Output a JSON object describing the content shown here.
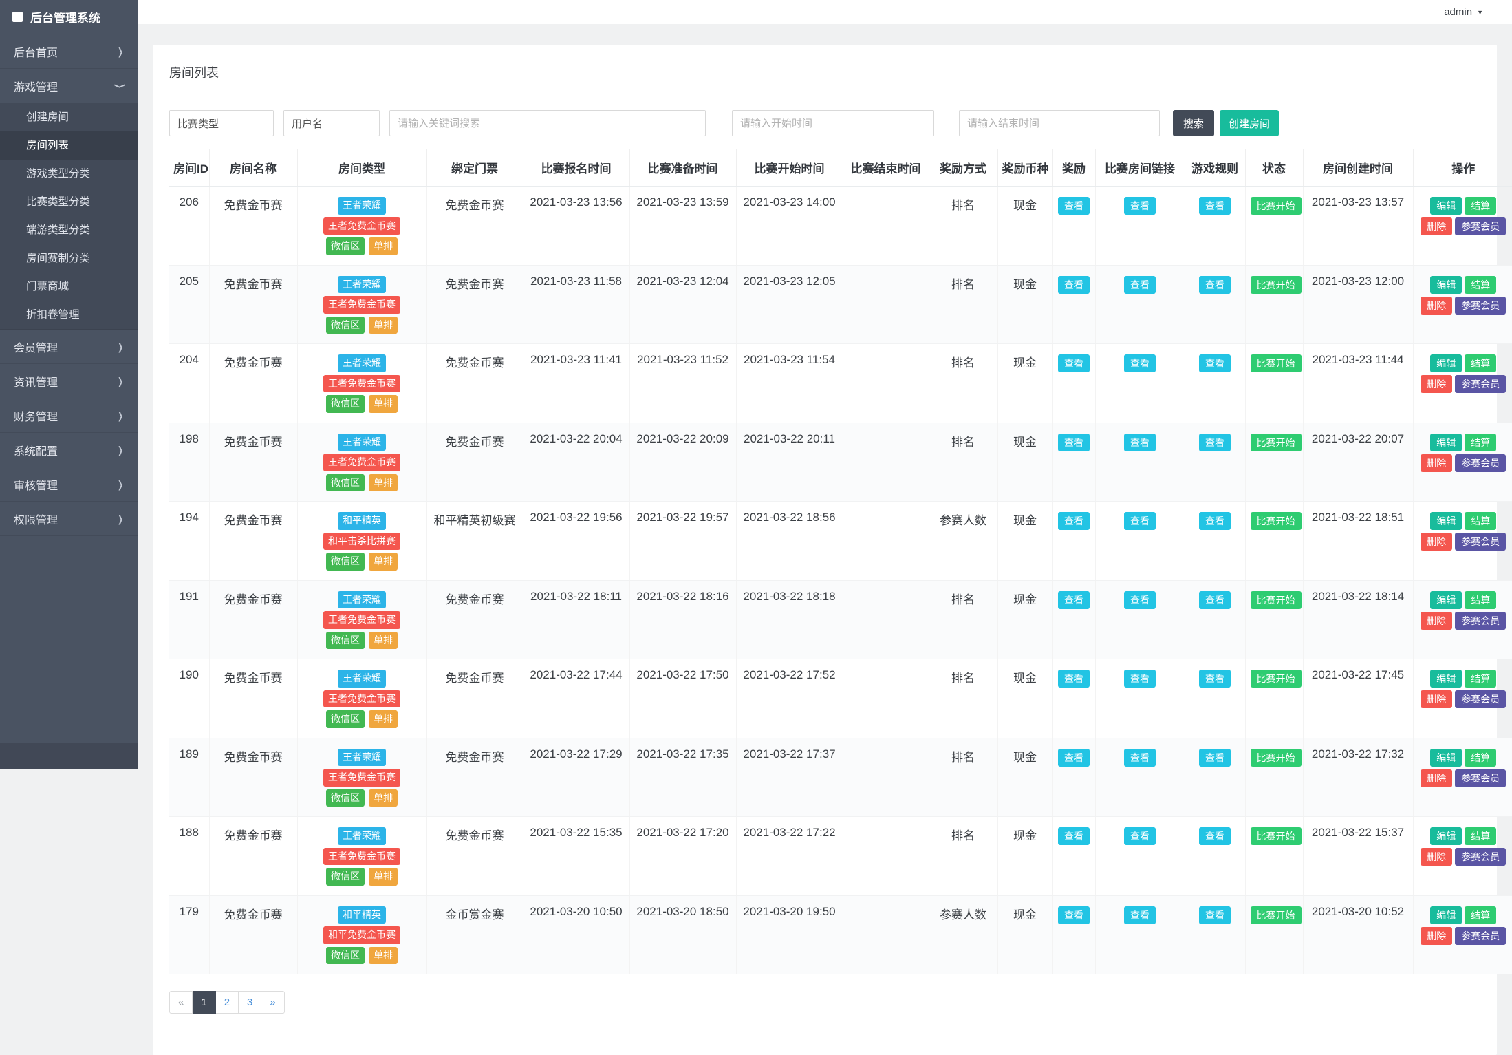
{
  "palette": {
    "sidebar": "#4a5362",
    "dark": "#424a57",
    "teal": "#18bc9c",
    "cyan": "#22c4e4",
    "blue": "#2cb4e8",
    "red": "#f4564e",
    "green": "#2ecc71",
    "grn2": "#42b852",
    "orange": "#f0a63e",
    "indigo": "#5a55a4"
  },
  "app": {
    "brand": "后台管理系统",
    "user": "admin"
  },
  "sidebar": {
    "home": "后台首页",
    "game": "游戏管理",
    "game_children": [
      "创建房间",
      "房间列表",
      "游戏类型分类",
      "比赛类型分类",
      "端游类型分类",
      "房间赛制分类",
      "门票商城",
      "折扣卷管理"
    ],
    "active_child": "房间列表",
    "others": [
      "会员管理",
      "资讯管理",
      "财务管理",
      "系统配置",
      "审核管理",
      "权限管理"
    ]
  },
  "page": {
    "title": "房间列表"
  },
  "filters": {
    "type_select": "比赛类型",
    "user_select": "用户名",
    "keyword_placeholder": "请输入关键词搜索",
    "start_placeholder": "请输入开始时间",
    "end_placeholder": "请输入结束时间",
    "search_label": "搜索",
    "create_label": "创建房间"
  },
  "table": {
    "headers": [
      "房间ID",
      "房间名称",
      "房间类型",
      "绑定门票",
      "比赛报名时间",
      "比赛准备时间",
      "比赛开始时间",
      "比赛结束时间",
      "奖励方式",
      "奖励币种",
      "奖励",
      "比赛房间链接",
      "游戏规则",
      "状态",
      "房间创建时间",
      "操作"
    ],
    "view_label": "查看",
    "actions": [
      {
        "key": "edit",
        "label": "编辑",
        "color": "teal"
      },
      {
        "key": "settle",
        "label": "结算",
        "color": "green"
      },
      {
        "key": "delete",
        "label": "删除",
        "color": "red"
      },
      {
        "key": "members",
        "label": "参赛会员",
        "color": "indigo"
      }
    ],
    "rows": [
      {
        "id": "206",
        "name": "免费金币赛",
        "badges": [
          {
            "text": "王者荣耀",
            "color": "blue"
          },
          {
            "text": "王者免费金币赛",
            "color": "red"
          },
          {
            "text": "微信区",
            "color": "grn2"
          },
          {
            "text": "单排",
            "color": "orange"
          }
        ],
        "ticket": "免费金币赛",
        "signup": "2021-03-23 13:56",
        "ready": "2021-03-23 13:59",
        "start": "2021-03-23 14:00",
        "end": "",
        "reward_mode": "排名",
        "currency": "现金",
        "status": "比赛开始",
        "created": "2021-03-23 13:57"
      },
      {
        "id": "205",
        "name": "免费金币赛",
        "badges": [
          {
            "text": "王者荣耀",
            "color": "blue"
          },
          {
            "text": "王者免费金币赛",
            "color": "red"
          },
          {
            "text": "微信区",
            "color": "grn2"
          },
          {
            "text": "单排",
            "color": "orange"
          }
        ],
        "ticket": "免费金币赛",
        "signup": "2021-03-23 11:58",
        "ready": "2021-03-23 12:04",
        "start": "2021-03-23 12:05",
        "end": "",
        "reward_mode": "排名",
        "currency": "现金",
        "status": "比赛开始",
        "created": "2021-03-23 12:00"
      },
      {
        "id": "204",
        "name": "免费金币赛",
        "badges": [
          {
            "text": "王者荣耀",
            "color": "blue"
          },
          {
            "text": "王者免费金币赛",
            "color": "red"
          },
          {
            "text": "微信区",
            "color": "grn2"
          },
          {
            "text": "单排",
            "color": "orange"
          }
        ],
        "ticket": "免费金币赛",
        "signup": "2021-03-23 11:41",
        "ready": "2021-03-23 11:52",
        "start": "2021-03-23 11:54",
        "end": "",
        "reward_mode": "排名",
        "currency": "现金",
        "status": "比赛开始",
        "created": "2021-03-23 11:44"
      },
      {
        "id": "198",
        "name": "免费金币赛",
        "badges": [
          {
            "text": "王者荣耀",
            "color": "blue"
          },
          {
            "text": "王者免费金币赛",
            "color": "red"
          },
          {
            "text": "微信区",
            "color": "grn2"
          },
          {
            "text": "单排",
            "color": "orange"
          }
        ],
        "ticket": "免费金币赛",
        "signup": "2021-03-22 20:04",
        "ready": "2021-03-22 20:09",
        "start": "2021-03-22 20:11",
        "end": "",
        "reward_mode": "排名",
        "currency": "现金",
        "status": "比赛开始",
        "created": "2021-03-22 20:07"
      },
      {
        "id": "194",
        "name": "免费金币赛",
        "badges": [
          {
            "text": "和平精英",
            "color": "blue"
          },
          {
            "text": "和平击杀比拼赛",
            "color": "red"
          },
          {
            "text": "微信区",
            "color": "grn2"
          },
          {
            "text": "单排",
            "color": "orange"
          }
        ],
        "ticket": "和平精英初级赛",
        "signup": "2021-03-22 19:56",
        "ready": "2021-03-22 19:57",
        "start": "2021-03-22 18:56",
        "end": "",
        "reward_mode": "参赛人数",
        "currency": "现金",
        "status": "比赛开始",
        "created": "2021-03-22 18:51"
      },
      {
        "id": "191",
        "name": "免费金币赛",
        "badges": [
          {
            "text": "王者荣耀",
            "color": "blue"
          },
          {
            "text": "王者免费金币赛",
            "color": "red"
          },
          {
            "text": "微信区",
            "color": "grn2"
          },
          {
            "text": "单排",
            "color": "orange"
          }
        ],
        "ticket": "免费金币赛",
        "signup": "2021-03-22 18:11",
        "ready": "2021-03-22 18:16",
        "start": "2021-03-22 18:18",
        "end": "",
        "reward_mode": "排名",
        "currency": "现金",
        "status": "比赛开始",
        "created": "2021-03-22 18:14"
      },
      {
        "id": "190",
        "name": "免费金币赛",
        "badges": [
          {
            "text": "王者荣耀",
            "color": "blue"
          },
          {
            "text": "王者免费金币赛",
            "color": "red"
          },
          {
            "text": "微信区",
            "color": "grn2"
          },
          {
            "text": "单排",
            "color": "orange"
          }
        ],
        "ticket": "免费金币赛",
        "signup": "2021-03-22 17:44",
        "ready": "2021-03-22 17:50",
        "start": "2021-03-22 17:52",
        "end": "",
        "reward_mode": "排名",
        "currency": "现金",
        "status": "比赛开始",
        "created": "2021-03-22 17:45"
      },
      {
        "id": "189",
        "name": "免费金币赛",
        "badges": [
          {
            "text": "王者荣耀",
            "color": "blue"
          },
          {
            "text": "王者免费金币赛",
            "color": "red"
          },
          {
            "text": "微信区",
            "color": "grn2"
          },
          {
            "text": "单排",
            "color": "orange"
          }
        ],
        "ticket": "免费金币赛",
        "signup": "2021-03-22 17:29",
        "ready": "2021-03-22 17:35",
        "start": "2021-03-22 17:37",
        "end": "",
        "reward_mode": "排名",
        "currency": "现金",
        "status": "比赛开始",
        "created": "2021-03-22 17:32"
      },
      {
        "id": "188",
        "name": "免费金币赛",
        "badges": [
          {
            "text": "王者荣耀",
            "color": "blue"
          },
          {
            "text": "王者免费金币赛",
            "color": "red"
          },
          {
            "text": "微信区",
            "color": "grn2"
          },
          {
            "text": "单排",
            "color": "orange"
          }
        ],
        "ticket": "免费金币赛",
        "signup": "2021-03-22 15:35",
        "ready": "2021-03-22 17:20",
        "start": "2021-03-22 17:22",
        "end": "",
        "reward_mode": "排名",
        "currency": "现金",
        "status": "比赛开始",
        "created": "2021-03-22 15:37"
      },
      {
        "id": "179",
        "name": "免费金币赛",
        "badges": [
          {
            "text": "和平精英",
            "color": "blue"
          },
          {
            "text": "和平免费金币赛",
            "color": "red"
          },
          {
            "text": "微信区",
            "color": "grn2"
          },
          {
            "text": "单排",
            "color": "orange"
          }
        ],
        "ticket": "金币赏金赛",
        "signup": "2021-03-20 10:50",
        "ready": "2021-03-20 18:50",
        "start": "2021-03-20 19:50",
        "end": "",
        "reward_mode": "参赛人数",
        "currency": "现金",
        "status": "比赛开始",
        "created": "2021-03-20 10:52"
      }
    ]
  },
  "pagination": {
    "prev": "«",
    "pages": [
      "1",
      "2",
      "3"
    ],
    "next": "»",
    "active_page": "1"
  }
}
